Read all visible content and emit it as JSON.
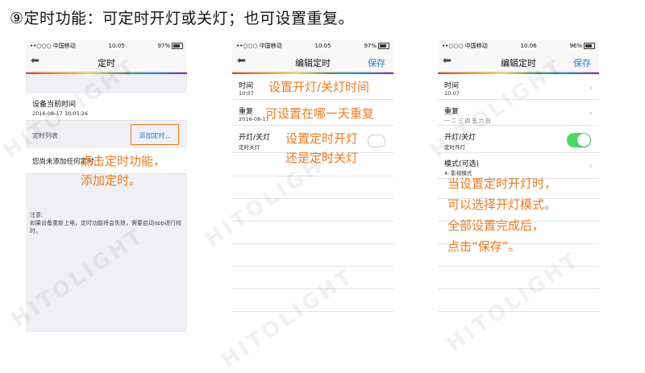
{
  "title": "⑨定时功能：可定时开灯或关灯；也可设置重复。",
  "watermark": "HITOLIGHT",
  "accent_orange": "#ee7a22",
  "accent_blue": "#2a7bd8",
  "toggle_green": "#4cd964",
  "screen1": {
    "status": {
      "carrier": "••○○○ 中国移动",
      "time": "10:05",
      "battery": "97%"
    },
    "nav_title": "定时",
    "device_time_label": "设备当前时间",
    "device_time_value": "2016-08-17 10:05:26",
    "list_label": "定时列表",
    "add_link": "添加定时...",
    "empty_text": "您尚未添加任何定时",
    "note_title": "注意:",
    "note_body": "如果设备重新上电，定时功能将会失效，需要启动app进行校时。",
    "annotation": [
      "点击定时功能，",
      "添加定时。"
    ]
  },
  "screen2": {
    "status": {
      "carrier": "••○○○ 中国移动",
      "time": "10:05",
      "battery": "97%"
    },
    "nav_title": "编辑定时",
    "save": "保存",
    "rows": [
      {
        "label": "时间",
        "sub": "10:07"
      },
      {
        "label": "重复",
        "sub": "2016-08-17"
      },
      {
        "label": "开灯/关灯",
        "sub": "定时关灯"
      }
    ],
    "annotations": [
      "设置开灯/关灯时间",
      "可设置在哪一天重复",
      "设置定时开灯",
      "还是定时关灯"
    ]
  },
  "screen3": {
    "status": {
      "carrier": "••○○○ 中国移动",
      "time": "10:06",
      "battery": "96%"
    },
    "nav_title": "编辑定时",
    "save": "保存",
    "rows": [
      {
        "label": "时间",
        "sub": "10:07"
      },
      {
        "label": "重复",
        "sub": "一 二 三 四 五 六 日"
      },
      {
        "label": "开灯/关灯",
        "sub": "定时开灯"
      },
      {
        "label": "模式(可选)",
        "sub": "4: 影视模式"
      }
    ],
    "annotation": [
      "当设置定时开灯时，",
      "可以选择开灯模式。",
      "全部设置完成后，",
      "点击“保存”。"
    ]
  }
}
